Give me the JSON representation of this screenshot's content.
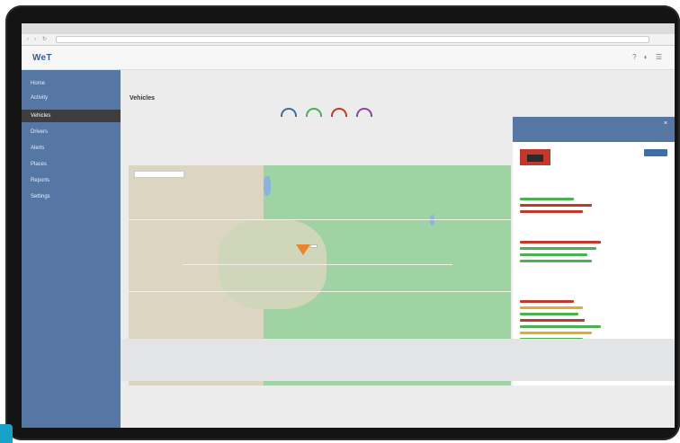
{
  "window": {
    "title": ""
  },
  "browser": {
    "url": ""
  },
  "app": {
    "logo": "WeT"
  },
  "header_icons": [
    "?",
    "◐",
    "☰"
  ],
  "sidebar": {
    "items": [
      {
        "label": "Home"
      },
      {
        "label": "Activity"
      },
      {
        "label": "Vehicles"
      },
      {
        "label": "Drivers"
      },
      {
        "label": "Alerts"
      },
      {
        "label": "Places"
      },
      {
        "label": "Reports"
      },
      {
        "label": "Settings"
      }
    ],
    "active_index": 2
  },
  "main": {
    "breadcrumb": "",
    "summary_title": "Vehicles",
    "stats": [],
    "gauge_colors": [
      "#3c6ea8",
      "#4caf50",
      "#c0392b",
      "#8e44ad"
    ]
  },
  "map": {
    "search_placeholder": "",
    "marker_label": "",
    "zoom_in": "+",
    "zoom_out": "−"
  },
  "panel": {
    "title": "",
    "subtitle": "",
    "close_icon": "×",
    "vehicle_name": "",
    "action_label": "",
    "sections": [
      {
        "title": ""
      },
      {
        "title": ""
      },
      {
        "title": ""
      }
    ]
  },
  "colors": {
    "sidebar": "#5677a4",
    "active": "#3e3e3e",
    "map_green": "#9fd3a3",
    "marker": "#e8852d",
    "accent": "#17a2c9"
  }
}
